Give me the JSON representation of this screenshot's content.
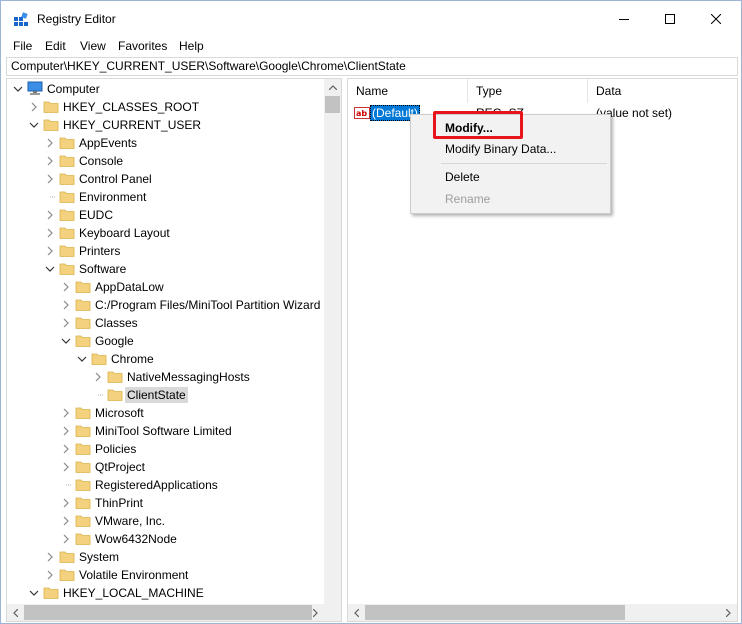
{
  "window": {
    "title": "Registry Editor",
    "controls": [
      "minimize",
      "maximize",
      "close"
    ]
  },
  "menu": [
    "File",
    "Edit",
    "View",
    "Favorites",
    "Help"
  ],
  "address": "Computer\\HKEY_CURRENT_USER\\Software\\Google\\Chrome\\ClientState",
  "tree": [
    {
      "label": "Computer",
      "depth": 0,
      "expanded": true,
      "icon": "computer-icon"
    },
    {
      "label": "HKEY_CLASSES_ROOT",
      "depth": 1,
      "expanded": false
    },
    {
      "label": "HKEY_CURRENT_USER",
      "depth": 1,
      "expanded": true
    },
    {
      "label": "AppEvents",
      "depth": 2,
      "expanded": false
    },
    {
      "label": "Console",
      "depth": 2,
      "expanded": false
    },
    {
      "label": "Control Panel",
      "depth": 2,
      "expanded": false
    },
    {
      "label": "Environment",
      "depth": 2,
      "leaf": true
    },
    {
      "label": "EUDC",
      "depth": 2,
      "expanded": false
    },
    {
      "label": "Keyboard Layout",
      "depth": 2,
      "expanded": false
    },
    {
      "label": "Printers",
      "depth": 2,
      "expanded": false
    },
    {
      "label": "Software",
      "depth": 2,
      "expanded": true
    },
    {
      "label": "AppDataLow",
      "depth": 3,
      "expanded": false
    },
    {
      "label": "C:/Program Files/MiniTool Partition Wizard",
      "depth": 3,
      "expanded": false
    },
    {
      "label": "Classes",
      "depth": 3,
      "expanded": false
    },
    {
      "label": "Google",
      "depth": 3,
      "expanded": true
    },
    {
      "label": "Chrome",
      "depth": 4,
      "expanded": true
    },
    {
      "label": "NativeMessagingHosts",
      "depth": 5,
      "expanded": false
    },
    {
      "label": "ClientState",
      "depth": 5,
      "leaf": true,
      "selected": true
    },
    {
      "label": "Microsoft",
      "depth": 3,
      "expanded": false
    },
    {
      "label": "MiniTool Software Limited",
      "depth": 3,
      "expanded": false
    },
    {
      "label": "Policies",
      "depth": 3,
      "expanded": false
    },
    {
      "label": "QtProject",
      "depth": 3,
      "expanded": false
    },
    {
      "label": "RegisteredApplications",
      "depth": 3,
      "leaf": true
    },
    {
      "label": "ThinPrint",
      "depth": 3,
      "expanded": false
    },
    {
      "label": "VMware, Inc.",
      "depth": 3,
      "expanded": false
    },
    {
      "label": "Wow6432Node",
      "depth": 3,
      "expanded": false
    },
    {
      "label": "System",
      "depth": 2,
      "expanded": false
    },
    {
      "label": "Volatile Environment",
      "depth": 2,
      "expanded": false
    },
    {
      "label": "HKEY_LOCAL_MACHINE",
      "depth": 1,
      "expanded": true
    }
  ],
  "list": {
    "columns": [
      "Name",
      "Type",
      "Data"
    ],
    "rows": [
      {
        "name": "(Default)",
        "type": "REG_SZ",
        "data": "(value not set)"
      }
    ]
  },
  "context_menu": {
    "items": [
      {
        "label": "Modify...",
        "bold": true,
        "enabled": true
      },
      {
        "label": "Modify Binary Data...",
        "enabled": true
      },
      {
        "separator": true
      },
      {
        "label": "Delete",
        "enabled": true
      },
      {
        "label": "Rename",
        "enabled": false
      }
    ]
  },
  "colors": {
    "selection": "#0078d7",
    "folder": "#f4d17e",
    "annotation": "#e8151c"
  }
}
